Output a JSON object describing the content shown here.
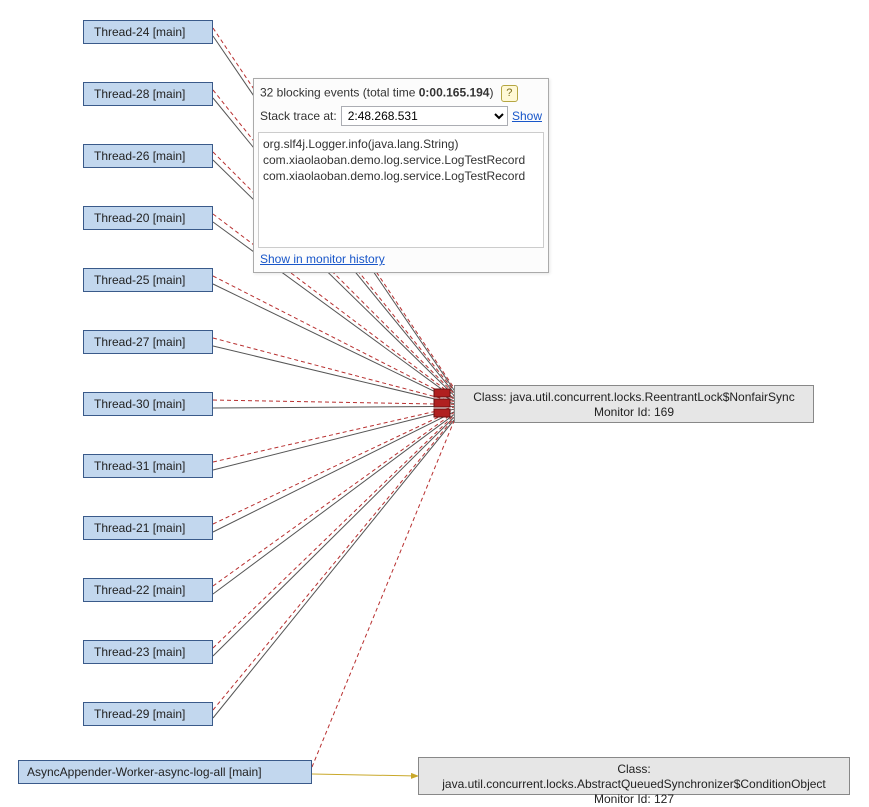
{
  "threads": [
    {
      "label": "Thread-24 [main]"
    },
    {
      "label": "Thread-28 [main]"
    },
    {
      "label": "Thread-26 [main]"
    },
    {
      "label": "Thread-20 [main]"
    },
    {
      "label": "Thread-25 [main]"
    },
    {
      "label": "Thread-27 [main]"
    },
    {
      "label": "Thread-30 [main]"
    },
    {
      "label": "Thread-31 [main]"
    },
    {
      "label": "Thread-21 [main]"
    },
    {
      "label": "Thread-22 [main]"
    },
    {
      "label": "Thread-23 [main]"
    },
    {
      "label": "Thread-29 [main]"
    }
  ],
  "async_thread": {
    "label": "AsyncAppender-Worker-async-log-all [main]"
  },
  "popup": {
    "events_prefix": "32 blocking events (total time ",
    "events_time": "0:00.165.194",
    "events_suffix": ")",
    "stack_label": "Stack trace at:",
    "selected_time": "2:48.268.531",
    "show_link": "Show",
    "stack_lines": [
      "org.slf4j.Logger.info(java.lang.String)",
      "com.xiaolaoban.demo.log.service.LogTestRecord",
      "com.xiaolaoban.demo.log.service.LogTestRecord"
    ],
    "footer_link": "Show in monitor history"
  },
  "monitors": {
    "nonfair": {
      "class": "Class: java.util.concurrent.locks.ReentrantLock$NonfairSync",
      "id": "Monitor Id: 169"
    },
    "condition": {
      "class": "Class: java.util.concurrent.locks.AbstractQueuedSynchronizer$ConditionObject",
      "id": "Monitor Id: 127"
    }
  }
}
